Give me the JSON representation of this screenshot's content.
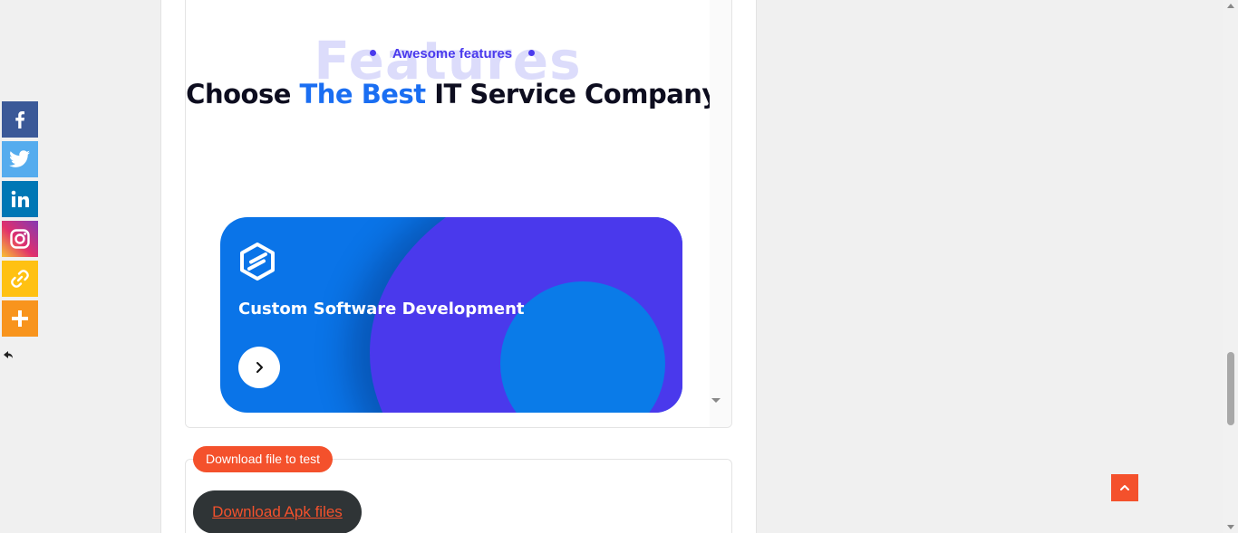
{
  "preview": {
    "ghost_title": "Features",
    "subtitle": "Awesome features",
    "heading_pre": "Choose",
    "heading_accent": "The Best",
    "heading_post": "IT Service Company",
    "card": {
      "title": "Custom Software Development",
      "logo_icon": "hexagon-logo-icon",
      "arrow_icon": "chevron-right-icon"
    }
  },
  "download": {
    "tag_label": "Download file to test",
    "button_label": "Download Apk files"
  },
  "share_bar": {
    "items": [
      {
        "name": "Facebook",
        "icon": "facebook-icon",
        "color": "#3b5998"
      },
      {
        "name": "Twitter",
        "icon": "twitter-icon",
        "color": "#55acee"
      },
      {
        "name": "LinkedIn",
        "icon": "linkedin-icon",
        "color": "#0077b5"
      },
      {
        "name": "Instagram",
        "icon": "instagram-icon",
        "color": "#e1306c"
      },
      {
        "name": "Copy Link",
        "icon": "link-icon",
        "color": "#ffc112"
      },
      {
        "name": "More",
        "icon": "plus-icon",
        "color": "#f8941d"
      }
    ],
    "hide_icon": "hide-arrow-icon"
  },
  "back_to_top_icon": "chevron-up-icon",
  "colors": {
    "accent_blue": "#1a6ef2",
    "purple": "#4a39ec",
    "orange": "#f4512c",
    "dark_button": "#2f3436"
  }
}
